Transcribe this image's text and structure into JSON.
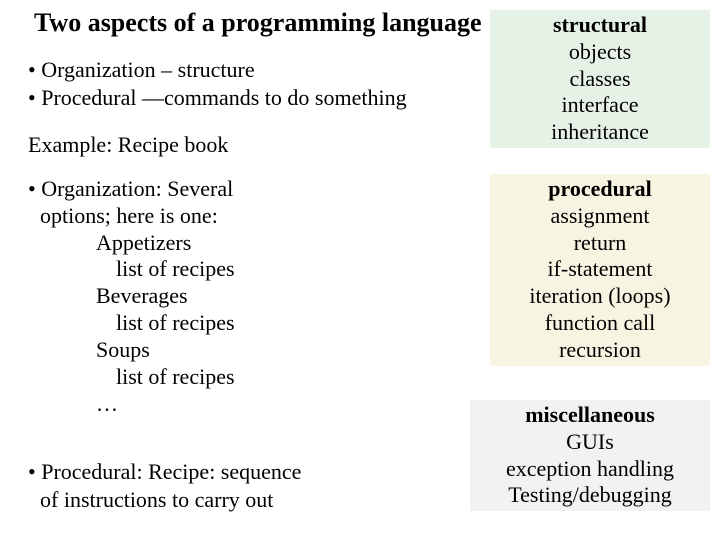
{
  "title": "Two aspects of a programming language",
  "bullets": {
    "b1": "• Organization – structure",
    "b2": "• Procedural —commands to do something"
  },
  "example": "Example: Recipe book",
  "org": {
    "l1": "• Organization: Several",
    "l2": "options; here is one:",
    "l3": "Appetizers",
    "l4": "list of recipes",
    "l5": "Beverages",
    "l6": "list of recipes",
    "l7": "Soups",
    "l8": "list of recipes",
    "l9": "…"
  },
  "proc": {
    "l1": "• Procedural: Recipe: sequence",
    "l2": "of instructions to carry out"
  },
  "panel_structural": {
    "hdr": "structural",
    "i1": "objects",
    "i2": "classes",
    "i3": "interface",
    "i4": "inheritance"
  },
  "panel_procedural": {
    "hdr": "procedural",
    "i1": "assignment",
    "i2": "return",
    "i3": "if-statement",
    "i4": "iteration (loops)",
    "i5": "function call",
    "i6": "recursion"
  },
  "panel_misc": {
    "hdr": "miscellaneous",
    "i1": "GUIs",
    "i2": "exception handling",
    "i3": "Testing/debugging"
  }
}
